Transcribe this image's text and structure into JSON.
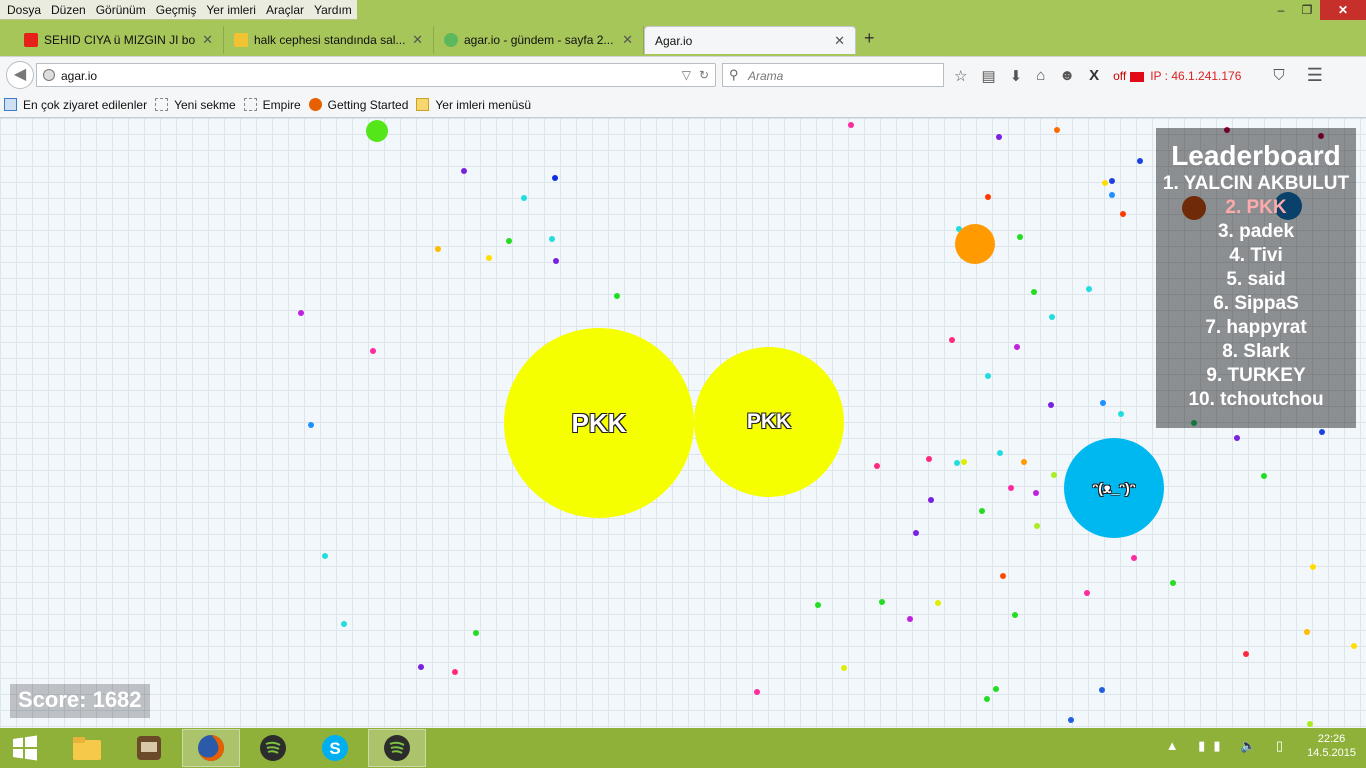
{
  "menu": [
    "Dosya",
    "Düzen",
    "Görünüm",
    "Geçmiş",
    "Yer imleri",
    "Araçlar",
    "Yardım"
  ],
  "window_controls": {
    "minimize": "–",
    "restore": "❐",
    "close": "✕"
  },
  "tabs": [
    {
      "title": "SEHID CIYA ü MIZGIN JI bo...",
      "icon": "youtube-icon",
      "color": "#e62117"
    },
    {
      "title": "halk cephesi standında sal...",
      "icon": "eksi-icon",
      "color": "#f1c232"
    },
    {
      "title": "agar.io - gündem - sayfa 2...",
      "icon": "drop-icon",
      "color": "#5cb85c"
    },
    {
      "title": "Agar.io",
      "icon": "blank-icon",
      "color": "#ffffff"
    }
  ],
  "new_tab": "+",
  "tab_close": "✕",
  "url": "agar.io",
  "search_placeholder": "Arama",
  "nav_icons": {
    "back": "◀",
    "reload": "↻",
    "dropdown": "▽",
    "bookmark": "☆",
    "reader": "▤",
    "download": "⬇",
    "home": "⌂",
    "chat": "☻",
    "x": "X",
    "shield": "⛉",
    "menu": "☰"
  },
  "vpn": {
    "status": "off",
    "ip": "IP : 46.1.241.176"
  },
  "bookmarks": [
    "En çok ziyaret edilenler",
    "Yeni sekme",
    "Empire",
    "Getting Started",
    "Yer imleri menüsü"
  ],
  "leaderboard": {
    "title": "Leaderboard",
    "entries": [
      "1. YALCIN AKBULUT",
      "2. PKK",
      "3. padek",
      "4. Tivi",
      "5. said",
      "6. SippaS",
      "7. happyrat",
      "8. Slark",
      "9. TURKEY",
      "10. tchoutchou"
    ],
    "highlight_index": 1
  },
  "score": "Score: 1682",
  "cells": {
    "pkk_name": "PKK",
    "blue_name": "ᵔ(ᴥ_ᵔ)ᵔ"
  },
  "taskbar": {
    "time": "22:26",
    "date": "14.5.2015",
    "tray": "▲ ▮▮ 🔈 ▯"
  },
  "colors": {
    "pkk": "#f5ff00",
    "blue_cell": "#00b8f0",
    "orange_cell": "#ff9a00",
    "green_cell": "#55e61a",
    "taskbar": "#8fb13a"
  }
}
